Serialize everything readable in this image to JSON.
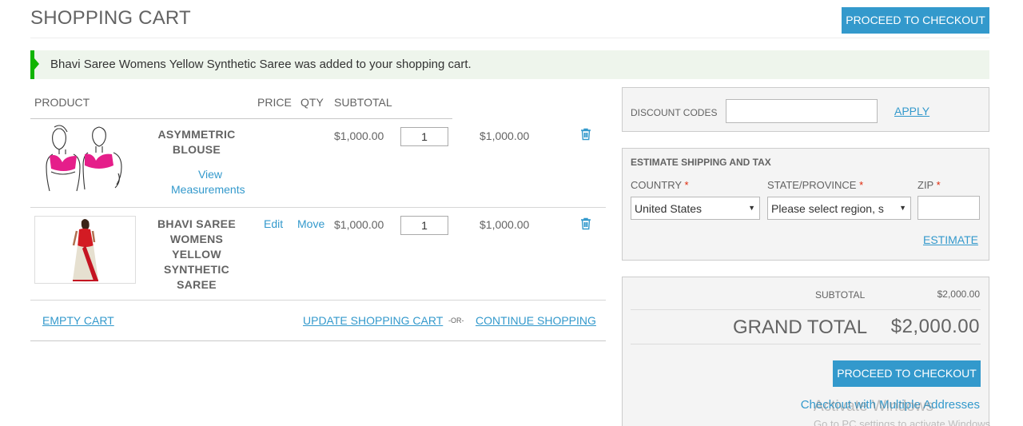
{
  "header": {
    "title": "SHOPPING CART",
    "checkout_label": "PROCEED TO CHECKOUT"
  },
  "message": "Bhavi Saree Womens Yellow Synthetic Saree was added to your shopping cart.",
  "table": {
    "headers": {
      "product": "PRODUCT",
      "price": "PRICE",
      "qty": "QTY",
      "subtotal": "SUBTOTAL"
    },
    "items": [
      {
        "name_lines": [
          "ASYMMETRIC",
          "BLOUSE"
        ],
        "link1": "View",
        "link2": "Measurements",
        "price": "$1,000.00",
        "qty": "1",
        "subtotal": "$1,000.00",
        "icon": "trash-icon"
      },
      {
        "name_lines": [
          "BHAVI SAREE",
          "WOMENS",
          "YELLOW",
          "SYNTHETIC",
          "SAREE"
        ],
        "edit_label": "Edit",
        "move_label": "Move",
        "price": "$1,000.00",
        "qty": "1",
        "subtotal": "$1,000.00",
        "icon": "trash-icon"
      }
    ],
    "footer": {
      "empty_cart": "EMPTY CART",
      "update_cart": "UPDATE SHOPPING CART",
      "or": "-OR-",
      "continue_shopping": "CONTINUE SHOPPING"
    }
  },
  "discount": {
    "label": "DISCOUNT CODES",
    "value": "",
    "apply": "APPLY"
  },
  "shipping": {
    "title": "ESTIMATE SHIPPING AND TAX",
    "country_label": "COUNTRY",
    "state_label": "STATE/PROVINCE",
    "zip_label": "ZIP",
    "required_mark": "*",
    "country_value": "United States",
    "state_value": "Please select region, s",
    "zip_value": "",
    "estimate": "ESTIMATE"
  },
  "totals": {
    "subtotal_label": "SUBTOTAL",
    "subtotal_value": "$2,000.00",
    "grand_label": "GRAND TOTAL",
    "grand_value": "$2,000.00",
    "checkout_label": "PROCEED TO CHECKOUT",
    "multi_address": "Checkout with Multiple Addresses"
  },
  "watermark": {
    "line1": "Activate Windows",
    "line2": "Go to PC settings to activate Windows."
  },
  "colors": {
    "accent": "#3399cc",
    "success_bar": "#11b400",
    "success_bg": "#eef5ec",
    "required": "#df280a"
  }
}
